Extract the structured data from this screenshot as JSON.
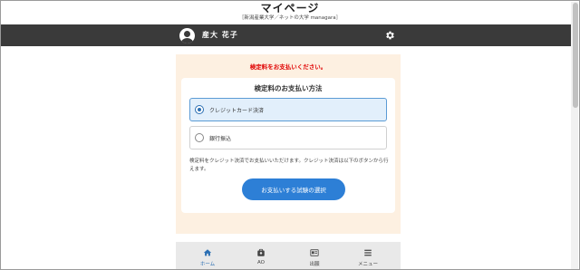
{
  "header": {
    "title": "マイページ",
    "subtitle": "［新潟産業大学／ネットの大学 managara］"
  },
  "userbar": {
    "username": "産大 花子",
    "avatar_icon": "user-avatar-icon",
    "settings_icon": "gear-icon"
  },
  "payment": {
    "notice": "検定料をお支払いください。",
    "method_title": "検定料のお支払い方法",
    "options": [
      {
        "label": "クレジットカード決済",
        "selected": true
      },
      {
        "label": "銀行振込",
        "selected": false
      }
    ],
    "description": "検定料をクレジット決済でお支払いいただけます。クレジット決済は以下のボタンから行えます。",
    "button_label": "お支払いする試験の選択"
  },
  "tabbar": {
    "tabs": [
      {
        "label": "ホーム",
        "icon": "home-icon",
        "active": true
      },
      {
        "label": "AO",
        "icon": "ao-icon",
        "active": false
      },
      {
        "label": "出願",
        "icon": "application-icon",
        "active": false
      },
      {
        "label": "メニュー",
        "icon": "menu-icon",
        "active": false
      }
    ]
  },
  "colors": {
    "accent": "#2d7fd6",
    "notice": "#e00000",
    "userbar": "#3a3a3a",
    "panel": "#fdf0e1"
  }
}
